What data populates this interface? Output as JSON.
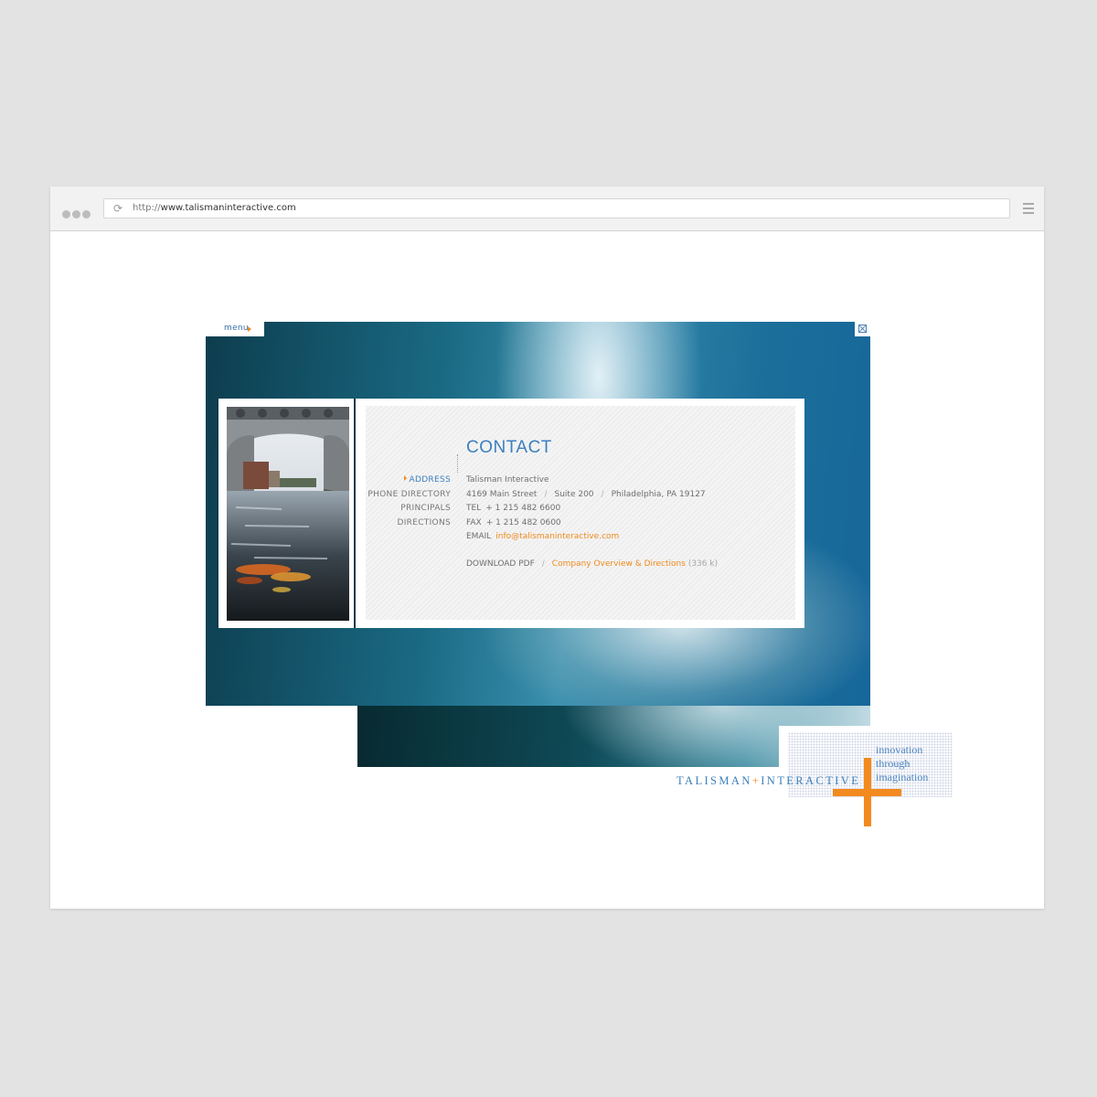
{
  "browser": {
    "url_scheme": "http://",
    "url_host": "www.talismaninteractive.com"
  },
  "site": {
    "menu_label": "menu",
    "heading": "CONTACT",
    "nav": [
      {
        "label": "ADDRESS",
        "active": true
      },
      {
        "label": "PHONE DIRECTORY",
        "active": false
      },
      {
        "label": "PRINCIPALS",
        "active": false
      },
      {
        "label": "DIRECTIONS",
        "active": false
      }
    ],
    "address": {
      "company": "Talisman Interactive",
      "street": "4169 Main Street",
      "suite": "Suite 200",
      "city": "Philadelphia, PA  19127",
      "tel_label": "TEL",
      "tel": "+ 1  215 482 6600",
      "fax_label": "FAX",
      "fax": "+ 1  215 482 0600",
      "email_label": "EMAIL",
      "email": "info@talismaninteractive.com",
      "download_label": "DOWNLOAD PDF",
      "download_link": "Company Overview & Directions",
      "download_size": "(336 k)"
    },
    "separator": "/",
    "logo": {
      "word1": "TALISMAN",
      "plus": "+",
      "word2": "INTERACTIVE",
      "tagline": [
        "innovation",
        "through",
        "imagination"
      ]
    },
    "colors": {
      "accent_blue": "#3c7fc0",
      "accent_orange": "#f28a1e"
    }
  }
}
